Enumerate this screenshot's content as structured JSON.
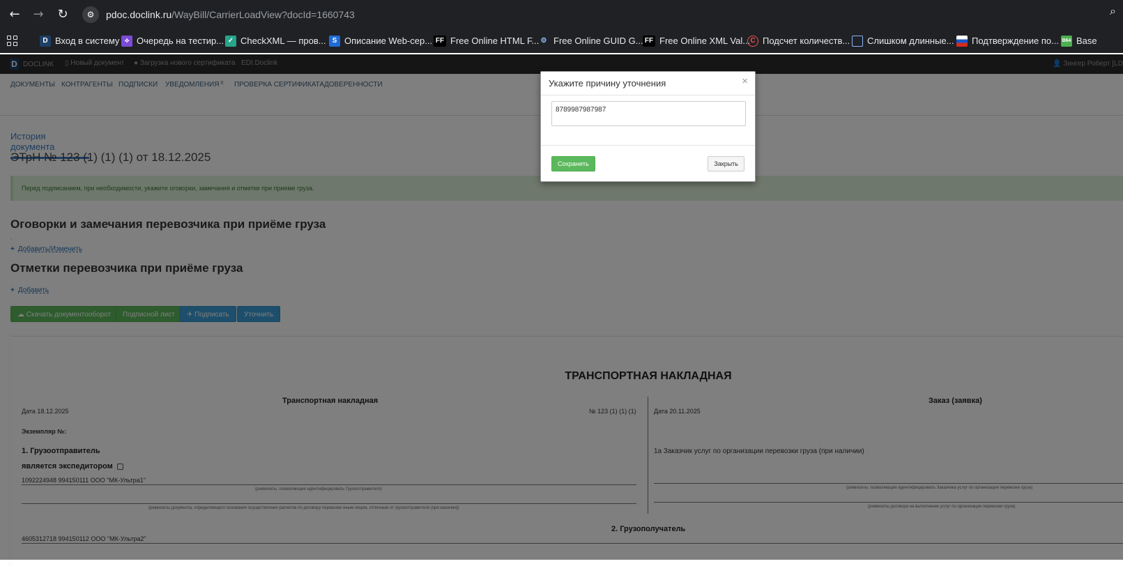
{
  "browser": {
    "url_domain": "pdoc.doclink.ru",
    "url_path": "/WayBill/CarrierLoadView?docId=1660743",
    "icons": [
      "back-icon",
      "forward-icon",
      "reload-icon",
      "site-settings-icon",
      "zoom-icon"
    ]
  },
  "bookmarks": [
    {
      "label": "Вход в систему",
      "icon": "D",
      "color": "#1e3f66"
    },
    {
      "label": "Очередь на тестир...",
      "icon": "⟡",
      "color": "#7b4bd6"
    },
    {
      "label": "CheckXML — пров...",
      "icon": "✓",
      "color": "#27a58a"
    },
    {
      "label": "Описание Web-сер...",
      "icon": "S",
      "color": "#1f6bd8"
    },
    {
      "label": "Free Online HTML F...",
      "icon": "FF",
      "color": "#000000"
    },
    {
      "label": "Free Online GUID G...",
      "icon": "⚙",
      "color": "#5a8cc8"
    },
    {
      "label": "Free Online XML Val...",
      "icon": "FF",
      "color": "#000000"
    },
    {
      "label": "Подсчет количеств...",
      "icon": "C",
      "color": "#d63b2f"
    },
    {
      "label": "Слишком длинные...",
      "icon": "▣",
      "color": "#2d6cdf"
    },
    {
      "label": "Подтверждение по...",
      "icon": "▬",
      "color": "#d52b1e"
    },
    {
      "label": "Base",
      "icon": "B64",
      "color": "#4caf50"
    }
  ],
  "app_top": {
    "logo": "DOCLINK",
    "new_doc": "Новый документ",
    "new_cert": "Загрузка нового сертификата",
    "edi": "EDI.Doclink",
    "user": "Зингер Роберт [LD"
  },
  "menu": {
    "documents": "ДОКУМЕНТЫ",
    "counterparties": "КОНТРАГЕНТЫ",
    "signatures": "ПОДПИСКИ",
    "notifications": "УВЕДОМЛЕНИЯ",
    "notifications_count": "0",
    "cert_check": "ПРОВЕРКА СЕРТИФИКАТА",
    "powers": "ДОВЕРЕННОСТИ"
  },
  "page": {
    "tab": "История документа",
    "doc_title": "ЭТрН №   123 (1) (1) (1)  от   18.12.2025",
    "alert": "Перед подписанием, при необходимости, укажите оговорки, замечания и отметки при приеме груза.",
    "section1_title": "Оговорки и замечания перевозчика при приёме груза",
    "section1_dot": ".",
    "section1_link": "Добавить/Изменить",
    "section2_title": "Отметки перевозчика при приёме груза",
    "section2_link": "Добавить",
    "btn_download": "Скачать документооборот",
    "btn_sheet": "Подписной лист",
    "btn_sign": "Подписать",
    "btn_clarify": "Уточнить"
  },
  "paper": {
    "title": "ТРАНСПОРТНАЯ НАКЛАДНАЯ",
    "left_header": "Транспортная накладная",
    "right_header": "Заказ (заявка)",
    "date_left": "Дата  18.12.2025",
    "number_left": "№   123 (1) (1) (1)",
    "date_right": "Дата 20.11.2025",
    "copy_label": "Экземпляр №:",
    "sender_label": "1. Грузоотправитель",
    "forwarder_label": "является экспедитором",
    "sender_value": "1092224948 994150111 ООО \"МК-Ультра1\"",
    "sender_hint": "(реквизиты, позволяющие идентифицировать Грузоотправителя)",
    "settlement_hint": "(реквизиты документа, определяющего основания осуществления расчетов по договору перевозки иным лицом, отличным от грузоотправителя (при наличии))",
    "customer_label": "1а Заказчик услуг по организации перевозки груза (при наличии)",
    "customer_hint": "(реквизиты, позволяющие идентифицировать Заказчика услуг по организации перевозки груза)",
    "contract_hint": "(реквизиты договора на выполнение услуг по организации перевозки груза)",
    "receiver_label": "2. Грузополучатель",
    "receiver_value": "4605312718 994150112 ООО \"МК-Ультра2\""
  },
  "modal": {
    "title": "Укажите причину уточнения",
    "close_glyph": "×",
    "textarea_value": "8789987987987",
    "save": "Сохранить",
    "close": "Закрыть"
  }
}
